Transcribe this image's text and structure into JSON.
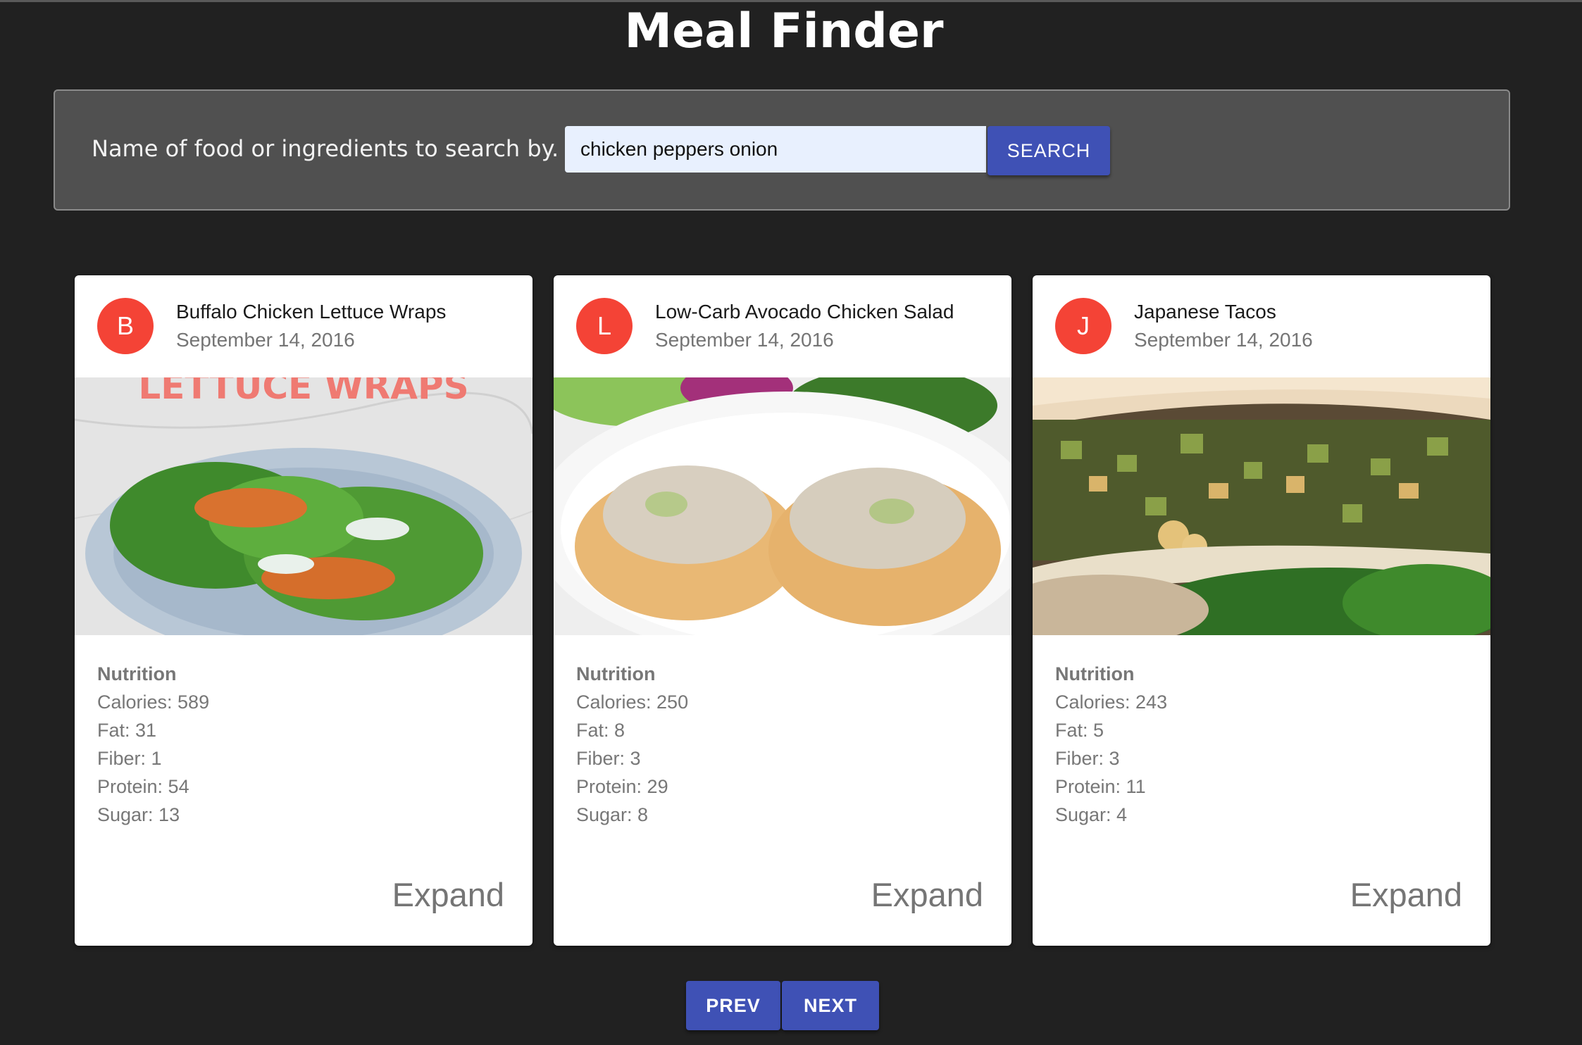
{
  "app": {
    "title": "Meal Finder"
  },
  "search": {
    "label": "Name of food or ingredients to search by.",
    "value": "chicken peppers onion",
    "button_label": "SEARCH"
  },
  "cards": [
    {
      "avatar_letter": "B",
      "title": "Buffalo Chicken Lettuce Wraps",
      "date": "September 14, 2016",
      "image_overlay_text": "LETTUCE WRAPS",
      "nutrition_heading": "Nutrition",
      "calories": "Calories: 589",
      "fat": "Fat: 31",
      "fiber": "Fiber: 1",
      "protein": "Protein: 54",
      "sugar": "Sugar: 13",
      "expand_label": "Expand"
    },
    {
      "avatar_letter": "L",
      "title": "Low-Carb Avocado Chicken Salad",
      "date": "September 14, 2016",
      "nutrition_heading": "Nutrition",
      "calories": "Calories: 250",
      "fat": "Fat: 8",
      "fiber": "Fiber: 3",
      "protein": "Protein: 29",
      "sugar": "Sugar: 8",
      "expand_label": "Expand"
    },
    {
      "avatar_letter": "J",
      "title": "Japanese Tacos",
      "date": "September 14, 2016",
      "nutrition_heading": "Nutrition",
      "calories": "Calories: 243",
      "fat": "Fat: 5",
      "fiber": "Fiber: 3",
      "protein": "Protein: 11",
      "sugar": "Sugar: 4",
      "expand_label": "Expand"
    }
  ],
  "pagination": {
    "prev_label": "PREV",
    "next_label": "NEXT"
  },
  "colors": {
    "accent": "#3f51b5",
    "avatar": "#f44336",
    "background": "#212121",
    "panel": "#505050"
  }
}
